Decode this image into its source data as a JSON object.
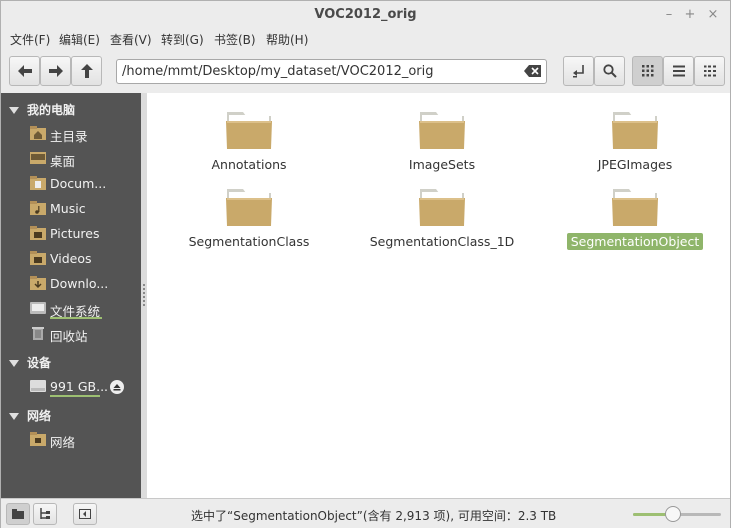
{
  "window": {
    "title": "VOC2012_orig"
  },
  "menu": [
    {
      "label": "文件(F)"
    },
    {
      "label": "编辑(E)"
    },
    {
      "label": "查看(V)"
    },
    {
      "label": "转到(G)"
    },
    {
      "label": "书签(B)"
    },
    {
      "label": "帮助(H)"
    }
  ],
  "location": {
    "path": "/home/mmt/Desktop/my_dataset/VOC2012_orig"
  },
  "sidebar": {
    "sections": [
      {
        "title": "我的电脑"
      },
      {
        "title": "设备"
      },
      {
        "title": "网络"
      }
    ],
    "computer_items": [
      {
        "label": "主目录",
        "icon": "home-folder-icon"
      },
      {
        "label": "桌面",
        "icon": "desktop-icon"
      },
      {
        "label": "Docum...",
        "icon": "documents-folder-icon"
      },
      {
        "label": "Music",
        "icon": "music-folder-icon"
      },
      {
        "label": "Pictures",
        "icon": "pictures-folder-icon"
      },
      {
        "label": "Videos",
        "icon": "videos-folder-icon"
      },
      {
        "label": "Downlo...",
        "icon": "downloads-folder-icon"
      },
      {
        "label": "文件系统",
        "icon": "filesystem-icon"
      },
      {
        "label": "回收站",
        "icon": "trash-icon"
      }
    ],
    "device_items": [
      {
        "label": "991 GB...",
        "icon": "drive-icon"
      }
    ],
    "network_items": [
      {
        "label": "网络",
        "icon": "network-icon"
      }
    ],
    "highlight_color": "#9dbf72"
  },
  "folders": [
    {
      "name": "Annotations"
    },
    {
      "name": "ImageSets"
    },
    {
      "name": "JPEGImages"
    },
    {
      "name": "SegmentationClass"
    },
    {
      "name": "SegmentationClass_1D"
    },
    {
      "name": "SegmentationObject",
      "selected": true
    }
  ],
  "status": {
    "text": "选中了“SegmentationObject”(含有 2,913 项), 可用空间：2.3 TB"
  },
  "zoom": {
    "level": 0.45
  },
  "colors": {
    "selection": "#8fb56a",
    "sidebar_bg": "#545454",
    "folder": "#c9a96a"
  }
}
